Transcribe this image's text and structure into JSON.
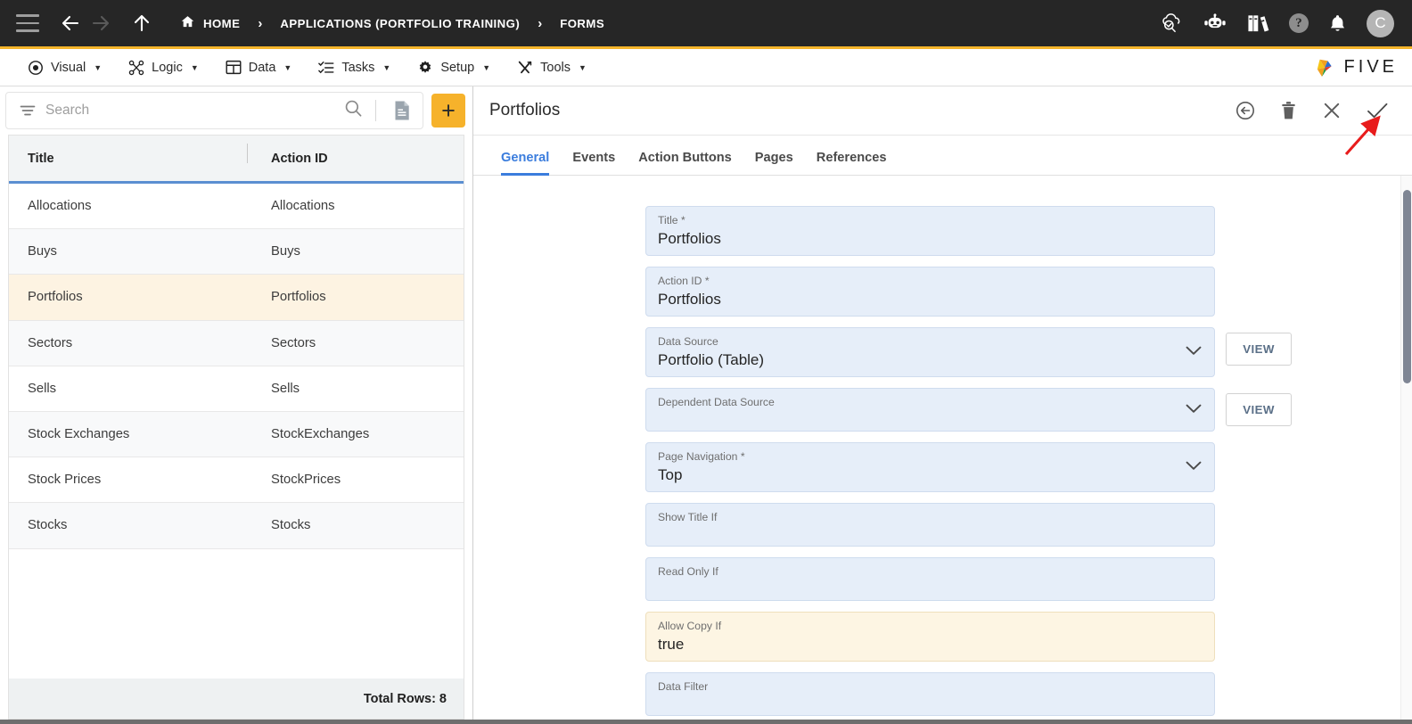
{
  "topbar": {
    "menu_icon": "hamburger-icon",
    "back_icon": "arrow-left-icon",
    "forward_icon": "arrow-right-icon",
    "up_icon": "arrow-up-icon",
    "breadcrumbs": [
      {
        "label": "HOME",
        "icon": "home-icon"
      },
      {
        "label": "APPLICATIONS (PORTFOLIO TRAINING)",
        "icon": ""
      },
      {
        "label": "FORMS",
        "icon": ""
      }
    ],
    "separator": "›",
    "right_icons": [
      "cloud-check-icon",
      "robot-chat-icon",
      "books-icon",
      "help-icon",
      "bell-icon"
    ],
    "help_glyph": "?",
    "avatar_initial": "C"
  },
  "menubar": {
    "items": [
      {
        "label": "Visual",
        "icon": "eye-icon"
      },
      {
        "label": "Logic",
        "icon": "flow-nodes-icon"
      },
      {
        "label": "Data",
        "icon": "table-grid-icon"
      },
      {
        "label": "Tasks",
        "icon": "checklist-icon"
      },
      {
        "label": "Setup",
        "icon": "gear-icon"
      },
      {
        "label": "Tools",
        "icon": "tools-icon"
      }
    ],
    "caret": "▼",
    "brand": "FIVE"
  },
  "left_panel": {
    "search": {
      "placeholder": "Search",
      "value": "",
      "filter_icon": "filter-icon",
      "search_icon": "search-icon",
      "document_icon": "document-icon",
      "add_label": "+"
    },
    "columns": [
      "Title",
      "Action ID"
    ],
    "rows": [
      {
        "title": "Allocations",
        "action_id": "Allocations",
        "selected": false
      },
      {
        "title": "Buys",
        "action_id": "Buys",
        "selected": false
      },
      {
        "title": "Portfolios",
        "action_id": "Portfolios",
        "selected": true
      },
      {
        "title": "Sectors",
        "action_id": "Sectors",
        "selected": false
      },
      {
        "title": "Sells",
        "action_id": "Sells",
        "selected": false
      },
      {
        "title": "Stock Exchanges",
        "action_id": "StockExchanges",
        "selected": false
      },
      {
        "title": "Stock Prices",
        "action_id": "StockPrices",
        "selected": false
      },
      {
        "title": "Stocks",
        "action_id": "Stocks",
        "selected": false
      }
    ],
    "footer": "Total Rows: 8"
  },
  "right_panel": {
    "title": "Portfolios",
    "actions": [
      {
        "name": "revert-icon",
        "label": "Revert"
      },
      {
        "name": "delete-icon",
        "label": "Delete"
      },
      {
        "name": "close-icon",
        "label": "Close"
      },
      {
        "name": "save-check-icon",
        "label": "Save"
      }
    ],
    "tabs": [
      {
        "label": "General",
        "active": true
      },
      {
        "label": "Events",
        "active": false
      },
      {
        "label": "Action Buttons",
        "active": false
      },
      {
        "label": "Pages",
        "active": false
      },
      {
        "label": "References",
        "active": false
      }
    ],
    "fields": [
      {
        "label": "Title *",
        "value": "Portfolios",
        "type": "text",
        "view": false,
        "highlight": false
      },
      {
        "label": "Action ID *",
        "value": "Portfolios",
        "type": "text",
        "view": false,
        "highlight": false
      },
      {
        "label": "Data Source",
        "value": "Portfolio (Table)",
        "type": "select",
        "view": true,
        "view_label": "VIEW",
        "highlight": false
      },
      {
        "label": "Dependent Data Source",
        "value": "",
        "type": "select",
        "view": true,
        "view_label": "VIEW",
        "highlight": false
      },
      {
        "label": "Page Navigation *",
        "value": "Top",
        "type": "select",
        "view": false,
        "highlight": false
      },
      {
        "label": "Show Title If",
        "value": "",
        "type": "text",
        "view": false,
        "highlight": false
      },
      {
        "label": "Read Only If",
        "value": "",
        "type": "text",
        "view": false,
        "highlight": false
      },
      {
        "label": "Allow Copy If",
        "value": "true",
        "type": "text",
        "view": false,
        "highlight": true
      },
      {
        "label": "Data Filter",
        "value": "",
        "type": "text",
        "view": false,
        "highlight": false
      }
    ]
  },
  "colors": {
    "topbar_bg": "#262626",
    "accent_yellow": "#f5b52b",
    "tab_active": "#3b7ddd",
    "field_bg": "#e6eef9",
    "field_highlight_bg": "#fdf5e3",
    "row_selected_bg": "#fdf3e2",
    "header_underline": "#5b8fd1",
    "annotation_arrow": "#e81c1c"
  },
  "annotation": {
    "arrow_color": "#e81c1c",
    "points_to": "save-check-icon"
  }
}
